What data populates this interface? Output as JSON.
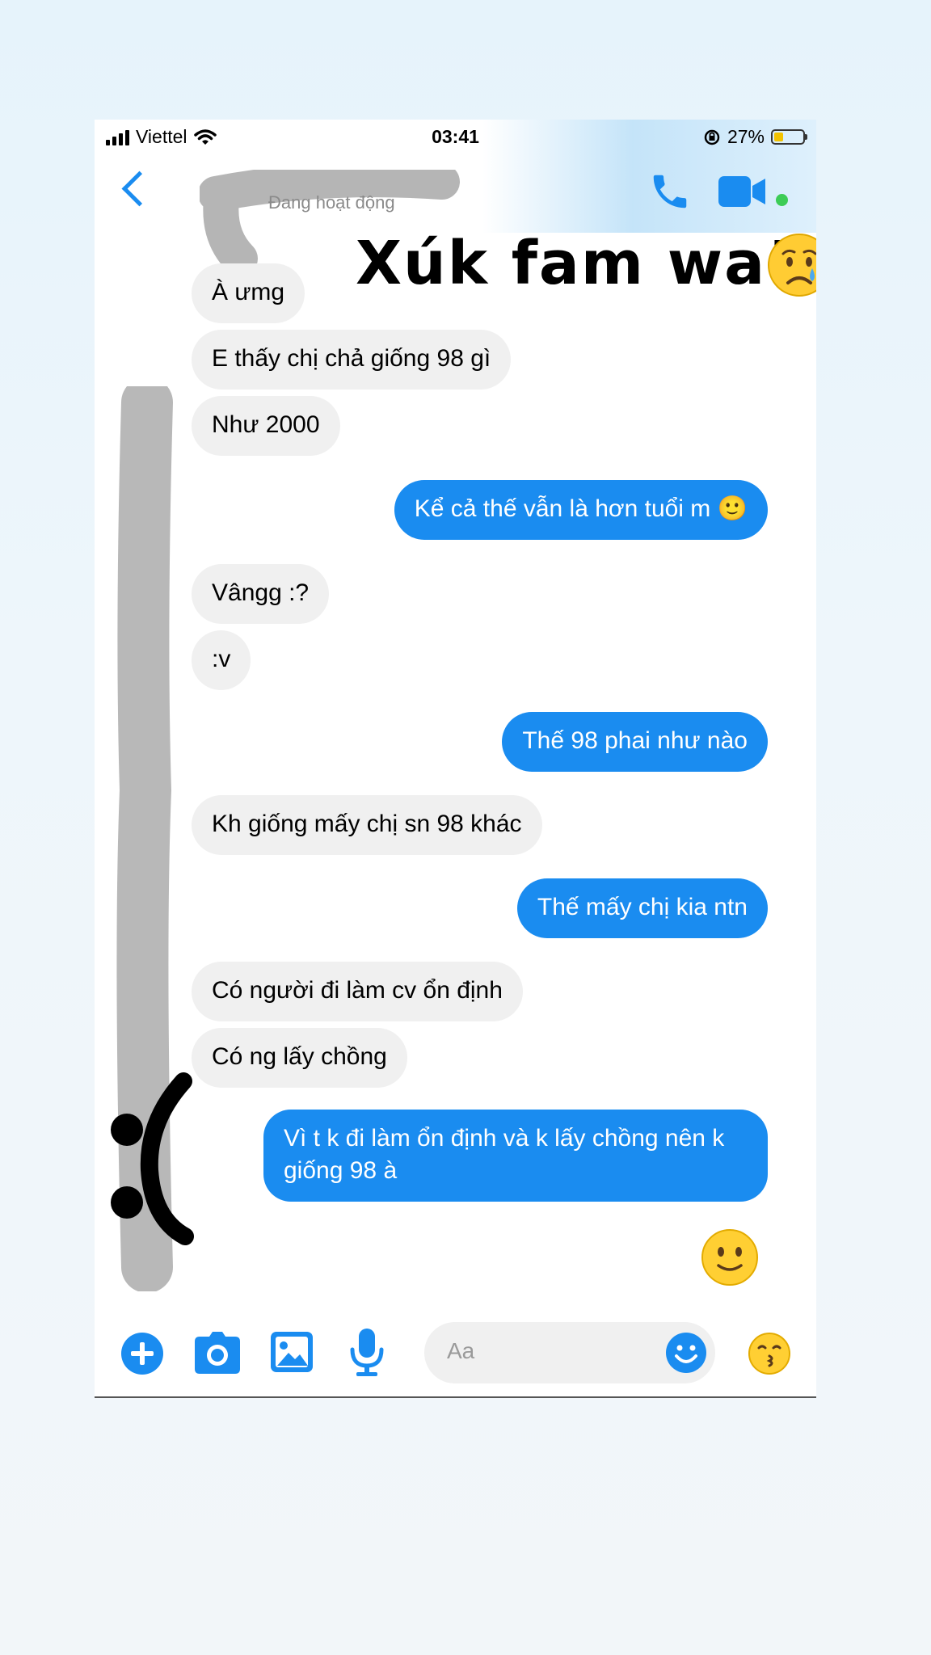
{
  "status_bar": {
    "carrier": "Viettel",
    "time": "03:41",
    "battery": "27%"
  },
  "header": {
    "subtitle": "Đang hoạt động"
  },
  "caption": "Xúk fam wa”",
  "messages": [
    {
      "side": "received",
      "text": "À ưmg"
    },
    {
      "side": "received",
      "text": "E thấy chị chả giống 98 gì"
    },
    {
      "side": "received",
      "text": "Như 2000"
    },
    {
      "side": "sent",
      "text": "Kể cả thế vẫn là hơn tuổi m 🙂"
    },
    {
      "side": "received",
      "text": "Vângg :?"
    },
    {
      "side": "received",
      "text": ":v"
    },
    {
      "side": "sent",
      "text": "Thế 98 phai như nào"
    },
    {
      "side": "received",
      "text": "Kh giống mấy chị sn 98 khác"
    },
    {
      "side": "sent",
      "text": "Thế mấy chị kia ntn"
    },
    {
      "side": "received",
      "text": "Có người đi làm cv ổn định"
    },
    {
      "side": "received",
      "text": "Có ng lấy chồng"
    },
    {
      "side": "sent",
      "text": "Vì t k đi làm ổn định và k lấy chồng nên k giống 98 à"
    }
  ],
  "composer": {
    "placeholder": "Aa"
  },
  "colors": {
    "accent": "#1a8cf0",
    "received_bubble": "#f0f0f0",
    "online": "#3ccc56"
  }
}
